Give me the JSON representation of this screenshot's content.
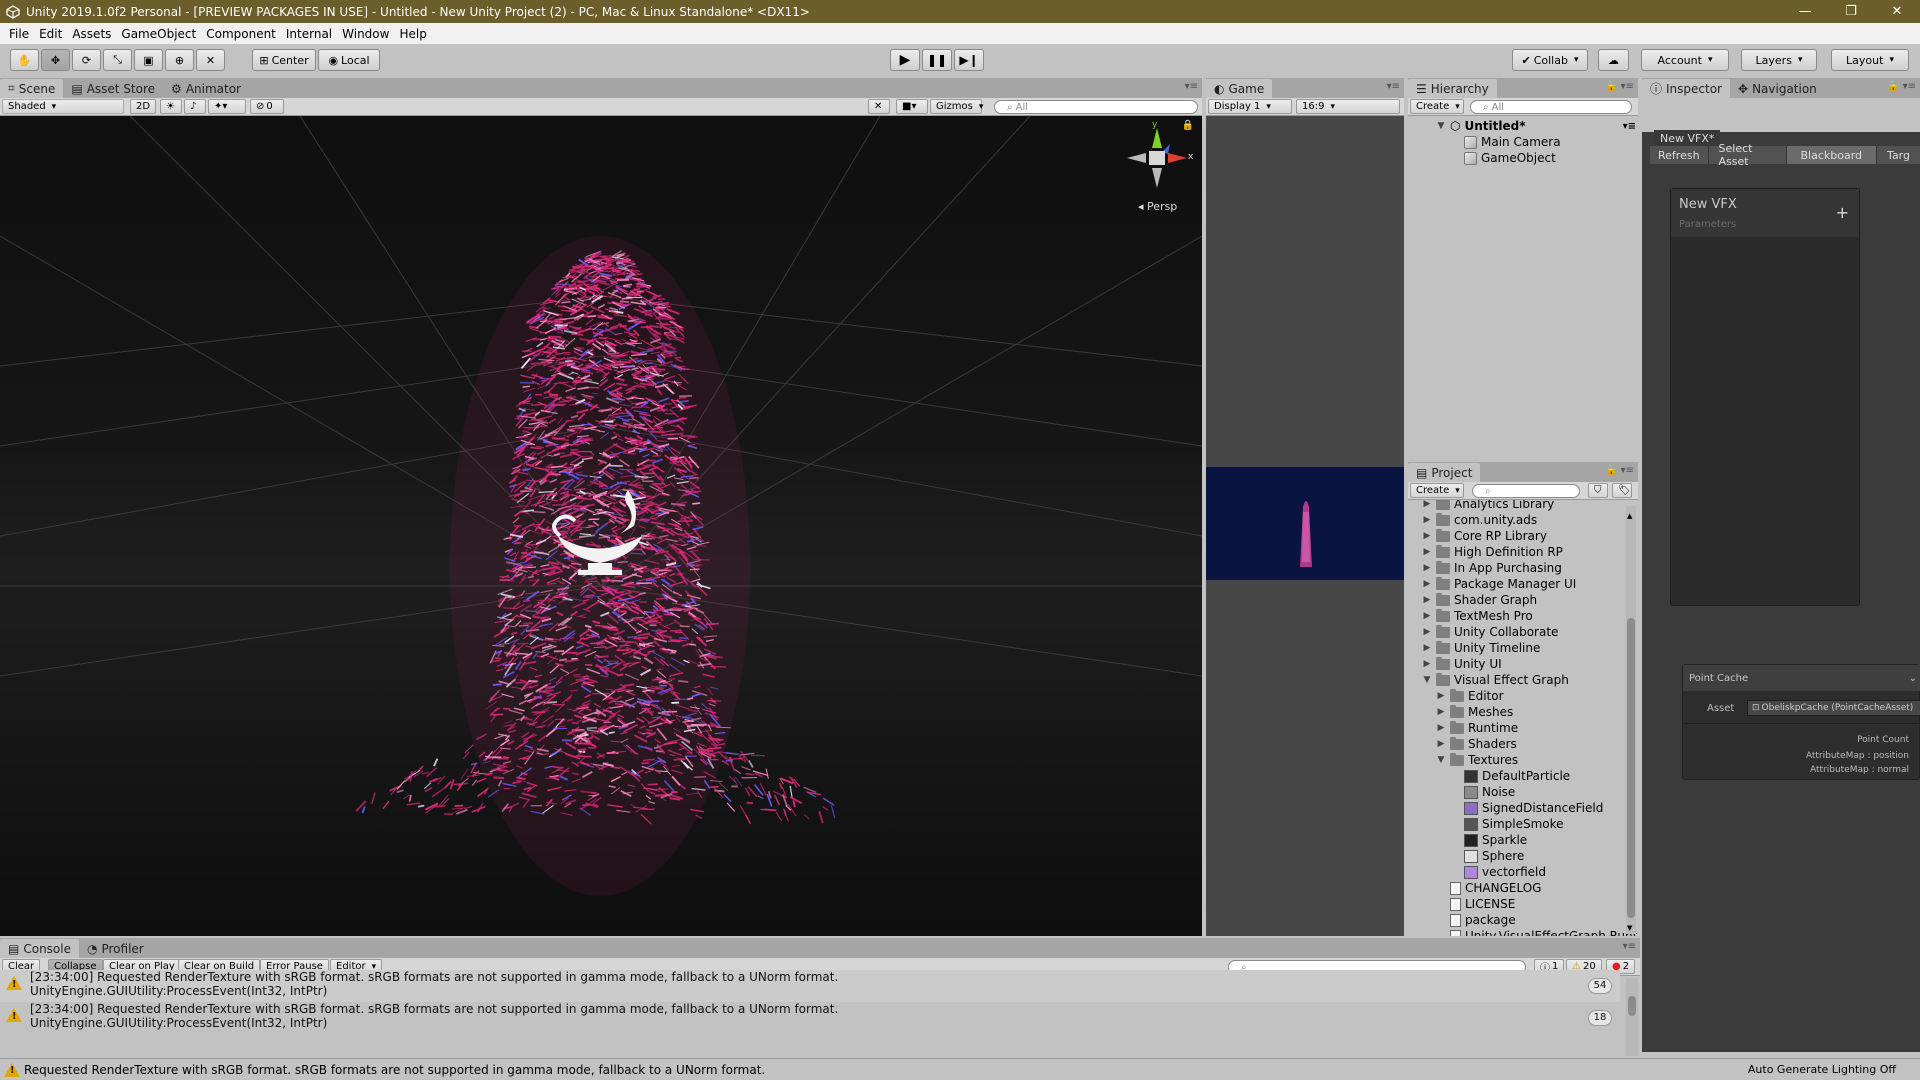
{
  "window": {
    "title": "Unity 2019.1.0f2 Personal - [PREVIEW PACKAGES IN USE] - Untitled - New Unity Project (2) - PC, Mac & Linux Standalone* <DX11>",
    "minimize": "—",
    "maximize": "❐",
    "close": "✕"
  },
  "menu": [
    "File",
    "Edit",
    "Assets",
    "GameObject",
    "Component",
    "Internal",
    "Window",
    "Help"
  ],
  "toolbar": {
    "pivot": "Center",
    "space": "Local",
    "collab": "Collab",
    "account": "Account",
    "layers": "Layers",
    "layout": "Layout"
  },
  "scene": {
    "tabs": [
      "Scene",
      "Asset Store",
      "Animator"
    ],
    "shading": "Shaded",
    "mode2d": "2D",
    "hidden_count": "0",
    "gizmos": "Gizmos",
    "search_placeholder": "All",
    "persp": "Persp",
    "gizmo_y": "y",
    "gizmo_x": "x",
    "colors": {
      "particles": "#e0287a",
      "particles_alt": "#6a5cff",
      "background": "#0f0f0f"
    }
  },
  "game": {
    "tab": "Game",
    "display": "Display 1",
    "aspect": "16:9",
    "background": "#0a1440"
  },
  "hierarchy": {
    "tab": "Hierarchy",
    "create": "Create",
    "search_placeholder": "All",
    "scene": "Untitled*",
    "objects": [
      "Main Camera",
      "GameObject"
    ]
  },
  "project": {
    "tab": "Project",
    "create": "Create",
    "items": [
      {
        "label": "Analytics Library",
        "depth": 0,
        "kind": "folder",
        "arrow": "▶"
      },
      {
        "label": "com.unity.ads",
        "depth": 0,
        "kind": "folder",
        "arrow": "▶"
      },
      {
        "label": "Core RP Library",
        "depth": 0,
        "kind": "folder",
        "arrow": "▶"
      },
      {
        "label": "High Definition RP",
        "depth": 0,
        "kind": "folder",
        "arrow": "▶"
      },
      {
        "label": "In App Purchasing",
        "depth": 0,
        "kind": "folder",
        "arrow": "▶"
      },
      {
        "label": "Package Manager UI",
        "depth": 0,
        "kind": "folder",
        "arrow": "▶"
      },
      {
        "label": "Shader Graph",
        "depth": 0,
        "kind": "folder",
        "arrow": "▶"
      },
      {
        "label": "TextMesh Pro",
        "depth": 0,
        "kind": "folder",
        "arrow": "▶"
      },
      {
        "label": "Unity Collaborate",
        "depth": 0,
        "kind": "folder",
        "arrow": "▶"
      },
      {
        "label": "Unity Timeline",
        "depth": 0,
        "kind": "folder",
        "arrow": "▶"
      },
      {
        "label": "Unity UI",
        "depth": 0,
        "kind": "folder",
        "arrow": "▶"
      },
      {
        "label": "Visual Effect Graph",
        "depth": 0,
        "kind": "folder",
        "arrow": "▼"
      },
      {
        "label": "Editor",
        "depth": 1,
        "kind": "folder",
        "arrow": "▶"
      },
      {
        "label": "Meshes",
        "depth": 1,
        "kind": "folder",
        "arrow": "▶"
      },
      {
        "label": "Runtime",
        "depth": 1,
        "kind": "folder",
        "arrow": "▶"
      },
      {
        "label": "Shaders",
        "depth": 1,
        "kind": "folder",
        "arrow": "▶"
      },
      {
        "label": "Textures",
        "depth": 1,
        "kind": "folder",
        "arrow": "▼"
      },
      {
        "label": "DefaultParticle",
        "depth": 2,
        "kind": "tex",
        "arrow": "",
        "color": "#333333"
      },
      {
        "label": "Noise",
        "depth": 2,
        "kind": "tex",
        "arrow": "",
        "color": "#8a8a8a"
      },
      {
        "label": "SignedDistanceField",
        "depth": 2,
        "kind": "tex",
        "arrow": "",
        "color": "#8c6fc0"
      },
      {
        "label": "SimpleSmoke",
        "depth": 2,
        "kind": "tex",
        "arrow": "",
        "color": "#555555"
      },
      {
        "label": "Sparkle",
        "depth": 2,
        "kind": "tex",
        "arrow": "",
        "color": "#222222"
      },
      {
        "label": "Sphere",
        "depth": 2,
        "kind": "tex",
        "arrow": "",
        "color": "#e0e0e0"
      },
      {
        "label": "vectorfield",
        "depth": 2,
        "kind": "tex",
        "arrow": "",
        "color": "#b088d8"
      },
      {
        "label": "CHANGELOG",
        "depth": 1,
        "kind": "file",
        "arrow": ""
      },
      {
        "label": "LICENSE",
        "depth": 1,
        "kind": "file",
        "arrow": ""
      },
      {
        "label": "package",
        "depth": 1,
        "kind": "file",
        "arrow": ""
      },
      {
        "label": "Unity.VisualEffectGraph.Runtime",
        "depth": 1,
        "kind": "file",
        "arrow": ""
      }
    ]
  },
  "inspector": {
    "tabs": [
      "Inspector",
      "Navigation"
    ],
    "vfx_tab": "New VFX*",
    "buttons": [
      "Refresh",
      "Select Asset",
      "Blackboard",
      "Targ"
    ],
    "blackboard_title": "New VFX",
    "blackboard_sub": "Parameters",
    "add": "+",
    "point_cache": {
      "title": "Point Cache",
      "asset_label": "Asset",
      "asset_value": "ObeliskpCache (PointCacheAsset)",
      "rows": [
        "Point Count",
        "AttributeMap : position",
        "AttributeMap : normal"
      ]
    }
  },
  "console": {
    "tabs": [
      "Console",
      "Profiler"
    ],
    "buttons": [
      "Clear",
      "Collapse",
      "Clear on Play",
      "Clear on Build",
      "Error Pause",
      "Editor"
    ],
    "counts": {
      "info": "1",
      "warn": "20",
      "error": "2"
    },
    "messages": [
      {
        "line1": "[23:34:00] Requested RenderTexture with sRGB format. sRGB formats are not supported in gamma mode, fallback to a UNorm format.",
        "line2": "UnityEngine.GUIUtility:ProcessEvent(Int32, IntPtr)",
        "count": "54"
      },
      {
        "line1": "[23:34:00] Requested RenderTexture with sRGB format. sRGB formats are not supported in gamma mode, fallback to a UNorm format.",
        "line2": "UnityEngine.GUIUtility:ProcessEvent(Int32, IntPtr)",
        "count": "18"
      }
    ]
  },
  "status": {
    "message": "Requested RenderTexture with sRGB format. sRGB formats are not supported in gamma mode, fallback to a UNorm format.",
    "right": "Auto Generate Lighting Off"
  }
}
